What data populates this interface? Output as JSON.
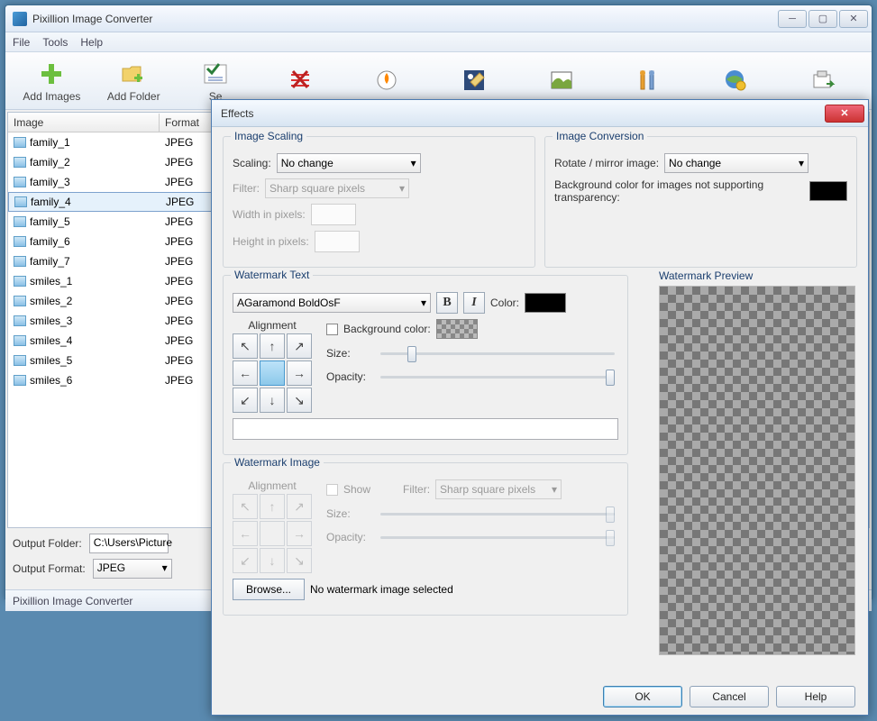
{
  "app": {
    "title": "Pixillion Image Converter",
    "status": "Pixillion Image Converter"
  },
  "menu": {
    "items": [
      "File",
      "Tools",
      "Help"
    ]
  },
  "toolbar": {
    "add_images": "Add Images",
    "add_folder": "Add Folder",
    "settings": "Se"
  },
  "table": {
    "headers": {
      "image": "Image",
      "format": "Format"
    },
    "rows": [
      {
        "name": "family_1",
        "format": "JPEG"
      },
      {
        "name": "family_2",
        "format": "JPEG"
      },
      {
        "name": "family_3",
        "format": "JPEG"
      },
      {
        "name": "family_4",
        "format": "JPEG",
        "selected": true
      },
      {
        "name": "family_5",
        "format": "JPEG"
      },
      {
        "name": "family_6",
        "format": "JPEG"
      },
      {
        "name": "family_7",
        "format": "JPEG"
      },
      {
        "name": "smiles_1",
        "format": "JPEG"
      },
      {
        "name": "smiles_2",
        "format": "JPEG"
      },
      {
        "name": "smiles_3",
        "format": "JPEG"
      },
      {
        "name": "smiles_4",
        "format": "JPEG"
      },
      {
        "name": "smiles_5",
        "format": "JPEG"
      },
      {
        "name": "smiles_6",
        "format": "JPEG"
      }
    ]
  },
  "output": {
    "folder_label": "Output Folder:",
    "folder_value": "C:\\Users\\Picture",
    "format_label": "Output Format:",
    "format_value": "JPEG"
  },
  "dialog": {
    "title": "Effects",
    "scaling_group": "Image Scaling",
    "scaling_label": "Scaling:",
    "scaling_value": "No change",
    "filter_label": "Filter:",
    "filter_value": "Sharp square pixels",
    "width_label": "Width in pixels:",
    "height_label": "Height in pixels:",
    "conversion_group": "Image Conversion",
    "rotate_label": "Rotate / mirror image:",
    "rotate_value": "No change",
    "bgcolor_label": "Background color for images not supporting transparency:",
    "wm_text_group": "Watermark Text",
    "wm_font": "AGaramond BoldOsF",
    "bold": "B",
    "italic": "I",
    "color_label": "Color:",
    "alignment_label": "Alignment",
    "bg_color_chk": "Background color:",
    "size_label": "Size:",
    "opacity_label": "Opacity:",
    "wm_image_group": "Watermark Image",
    "show_label": "Show",
    "browse": "Browse...",
    "no_image": "No watermark image selected",
    "preview_label": "Watermark Preview",
    "ok": "OK",
    "cancel": "Cancel",
    "help": "Help"
  }
}
